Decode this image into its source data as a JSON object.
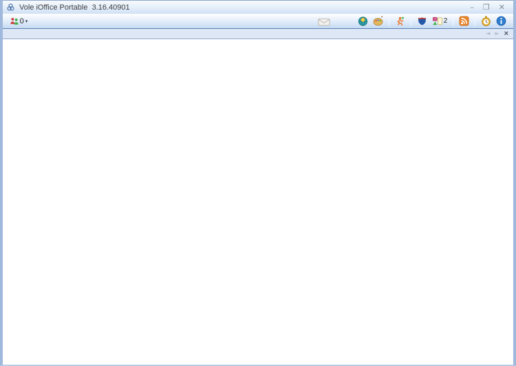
{
  "window": {
    "title": "Vole iOffice Portable  3.16.40901",
    "controls": {
      "minimize_glyph": "–",
      "maximize_glyph": "❐",
      "close_glyph": "✕"
    }
  },
  "toolbar": {
    "users": {
      "count": "0",
      "dropdown_glyph": "▾"
    },
    "document_badge_count": "2"
  },
  "tabstrip": {
    "nav_left_glyph": "◄",
    "nav_right_glyph": "►",
    "close_glyph": "×"
  },
  "colors": {
    "frame_border": "#9fb8db",
    "toolbar_bottom_edge": "#587eb4",
    "tabstrip_bg": "#dde7f5",
    "info_blue": "#2f7ed0",
    "rss_orange": "#e8862c",
    "stopwatch_gold": "#e9b53f",
    "globe_teal": "#2e9ea6",
    "runner_orange": "#e8762c",
    "shield_blue": "#2458a8"
  }
}
